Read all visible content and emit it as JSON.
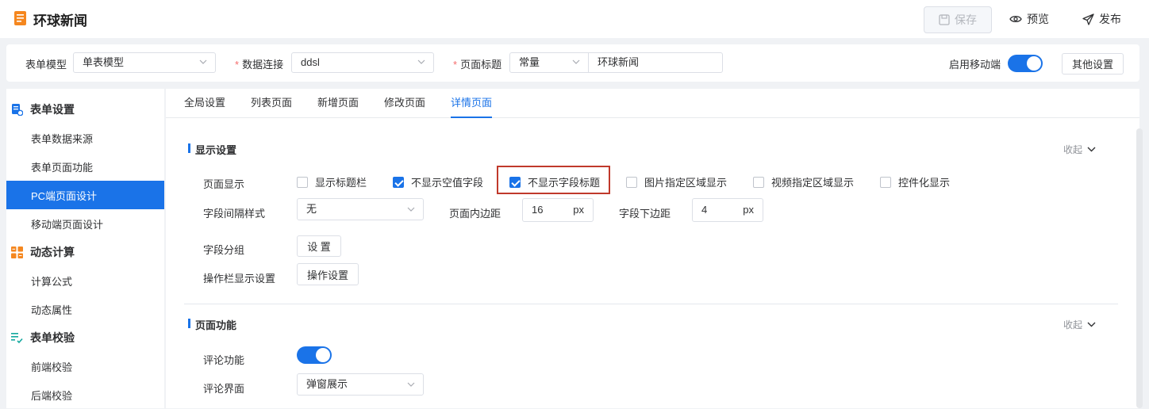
{
  "header": {
    "app_title": "环球新闻",
    "save_label": "保存",
    "preview_label": "预览",
    "publish_label": "发布"
  },
  "config": {
    "form_model_label": "表单模型",
    "form_model_value": "单表模型",
    "data_conn_label": "数据连接",
    "data_conn_value": "ddsl",
    "page_title_label": "页面标题",
    "page_title_type": "常量",
    "page_title_value": "环球新闻",
    "mobile_label": "启用移动端",
    "mobile_enabled": true,
    "other_settings": "其他设置"
  },
  "sidebar": {
    "groups": [
      {
        "label": "表单设置",
        "items": [
          "表单数据来源",
          "表单页面功能",
          "PC端页面设计",
          "移动端页面设计"
        ]
      },
      {
        "label": "动态计算",
        "items": [
          "计算公式",
          "动态属性"
        ]
      },
      {
        "label": "表单校验",
        "items": [
          "前端校验",
          "后端校验"
        ]
      }
    ],
    "active_item": "PC端页面设计"
  },
  "tabs": [
    "全局设置",
    "列表页面",
    "新增页面",
    "修改页面",
    "详情页面"
  ],
  "active_tab": "详情页面",
  "display": {
    "section_title": "显示设置",
    "collapse_label": "收起",
    "page_display_label": "页面显示",
    "checkboxes": [
      {
        "label": "显示标题栏",
        "checked": false
      },
      {
        "label": "不显示空值字段",
        "checked": true
      },
      {
        "label": "不显示字段标题",
        "checked": true
      },
      {
        "label": "图片指定区域显示",
        "checked": false
      },
      {
        "label": "视频指定区域显示",
        "checked": false
      },
      {
        "label": "控件化显示",
        "checked": false
      }
    ],
    "spacing_label": "字段间隔样式",
    "spacing_value": "无",
    "padding_label": "页面内边距",
    "padding_value": "16",
    "margin_label": "字段下边距",
    "margin_value": "4",
    "unit": "px",
    "group_label": "字段分组",
    "group_button": "设 置",
    "action_label": "操作栏显示设置",
    "action_button": "操作设置"
  },
  "function": {
    "section_title": "页面功能",
    "collapse_label": "收起",
    "comment_label": "评论功能",
    "comment_enabled": true,
    "comment_ui_label": "评论界面",
    "comment_ui_value": "弹窗展示"
  },
  "colors": {
    "accent": "#1a73e8",
    "highlight": "#c0392b"
  }
}
